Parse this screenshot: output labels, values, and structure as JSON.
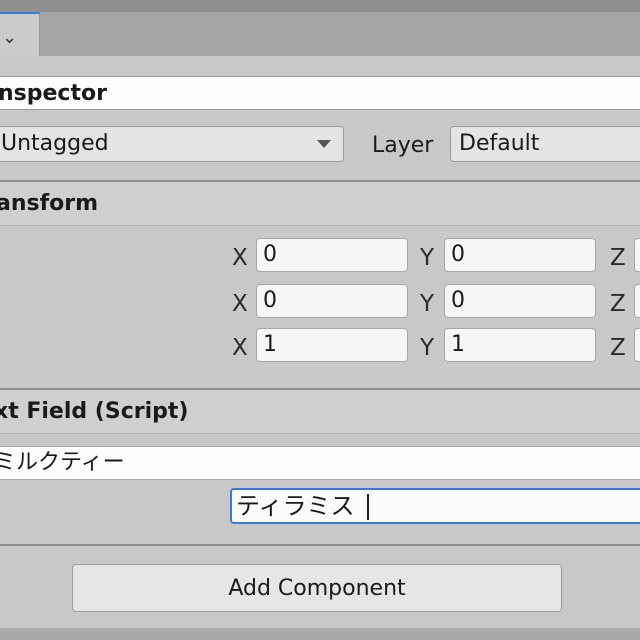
{
  "tab": {
    "icon": "chevron-down-icon"
  },
  "inspector": {
    "title": "nspector",
    "tag": {
      "value": "Untagged"
    },
    "layer": {
      "label": "Layer",
      "value": "Default"
    }
  },
  "transform": {
    "title": "ansform",
    "rows": [
      {
        "x_label": "X",
        "x": "0",
        "y_label": "Y",
        "y": "0",
        "z_label": "Z"
      },
      {
        "x_label": "X",
        "x": "0",
        "y_label": "Y",
        "y": "0",
        "z_label": "Z"
      },
      {
        "x_label": "X",
        "x": "1",
        "y_label": "Y",
        "y": "1",
        "z_label": "Z"
      }
    ]
  },
  "text_field_component": {
    "title": "xt Field (Script)",
    "label_text": "ミルクティー",
    "input_value": "ティラミス"
  },
  "add_component": {
    "label": "Add Component"
  },
  "colors": {
    "accent": "#3a79d8",
    "panel": "#c8c8c8"
  }
}
